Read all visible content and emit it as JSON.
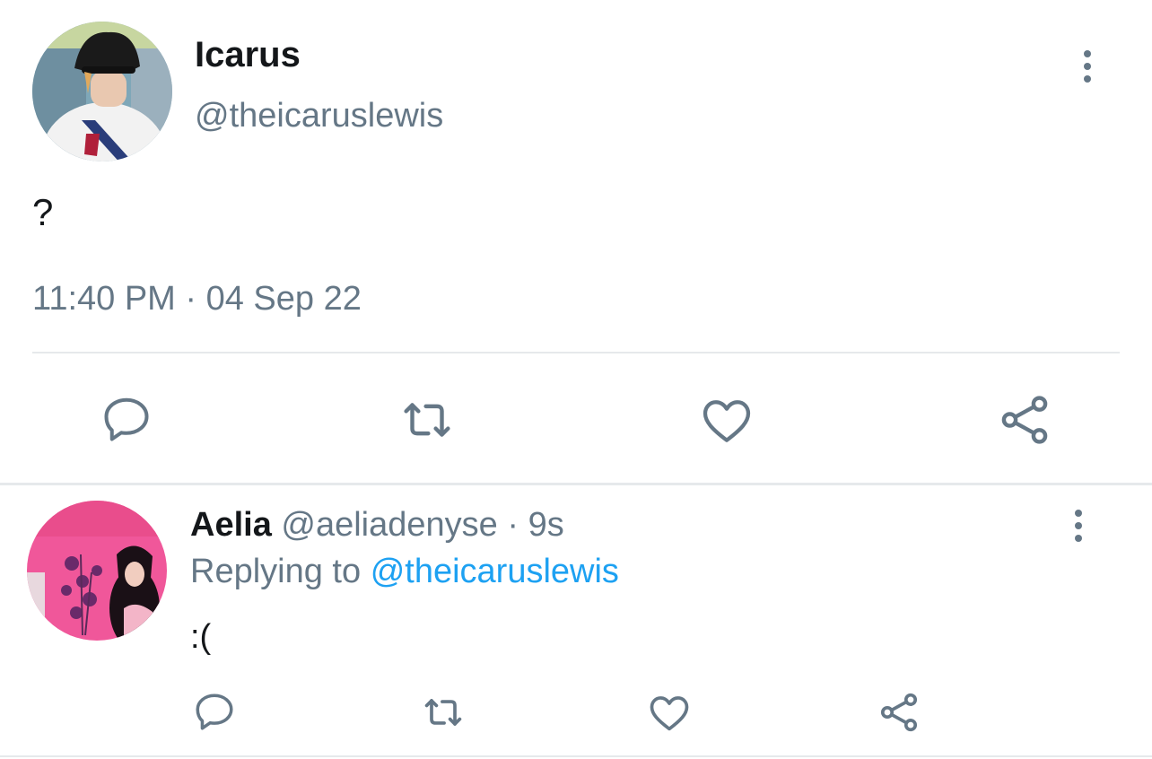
{
  "main_tweet": {
    "display_name": "Icarus",
    "handle": "@theicaruslewis",
    "text": "?",
    "timestamp": "11:40 PM · 04 Sep 22",
    "avatar_icon": "avatar-photo-person-in-black-cap",
    "actions": [
      "reply-icon",
      "retweet-icon",
      "like-icon",
      "share-icon"
    ]
  },
  "reply": {
    "display_name": "Aelia",
    "handle": "@aeliadenyse",
    "separator": "·",
    "time_ago": "9s",
    "replying_prefix": "Replying to",
    "replying_handle": "@theicaruslewis",
    "text": ":(",
    "avatar_icon": "avatar-photo-person-pink-background",
    "actions": [
      "reply-icon",
      "retweet-icon",
      "like-icon",
      "share-icon"
    ]
  },
  "colors": {
    "text": "#14171a",
    "muted": "#657786",
    "link": "#1da1f2",
    "divider": "#e6e9eb"
  }
}
